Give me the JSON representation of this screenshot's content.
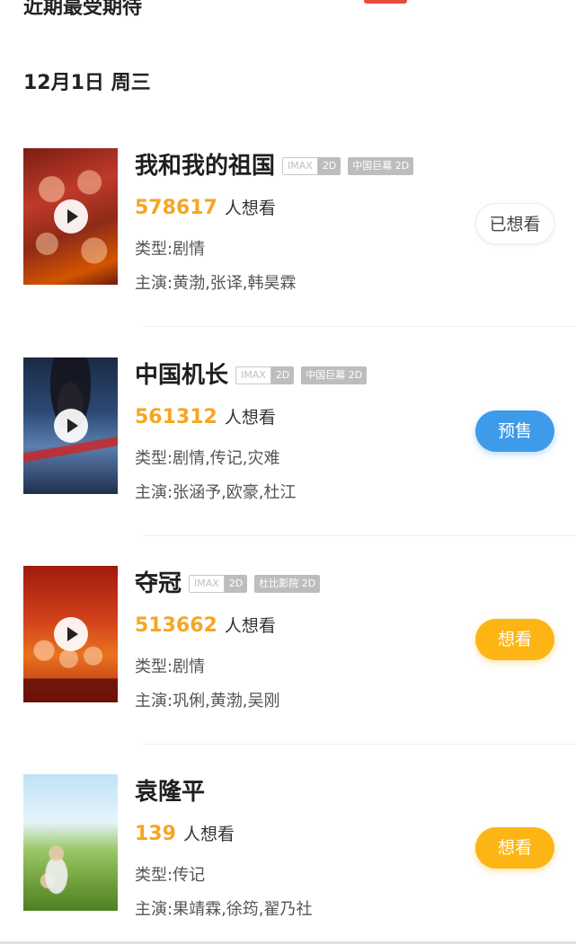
{
  "section": {
    "title": "近期最受期待"
  },
  "date": {
    "label": "12月1日 周三"
  },
  "common": {
    "want_suffix": "人想看"
  },
  "colors": {
    "accent": "#f5a623",
    "presale": "#3d9be9",
    "want": "#fdb515"
  },
  "movies": [
    {
      "title": "我和我的祖国",
      "badges": [
        {
          "left": "IMAX",
          "right": "2D"
        },
        {
          "text": "中国巨幕 2D"
        }
      ],
      "want_count": "578617",
      "genre": "类型:剧情",
      "cast": "主演:黄渤,张译,韩昊霖",
      "action": "已想看",
      "has_trailer": true
    },
    {
      "title": "中国机长",
      "badges": [
        {
          "left": "IMAX",
          "right": "2D"
        },
        {
          "text": "中国巨幕 2D"
        }
      ],
      "want_count": "561312",
      "genre": "类型:剧情,传记,灾难",
      "cast": "主演:张涵予,欧豪,杜江",
      "action": "预售",
      "has_trailer": true
    },
    {
      "title": "夺冠",
      "badges": [
        {
          "left": "IMAX",
          "right": "2D"
        },
        {
          "text": "杜比影院 2D"
        }
      ],
      "want_count": "513662",
      "genre": "类型:剧情",
      "cast": "主演:巩俐,黄渤,吴刚",
      "action": "想看",
      "has_trailer": true
    },
    {
      "title": "袁隆平",
      "badges": [],
      "want_count": "139",
      "genre": "类型:传记",
      "cast": "主演:果靖霖,徐筠,翟乃社",
      "action": "想看",
      "has_trailer": false
    }
  ]
}
